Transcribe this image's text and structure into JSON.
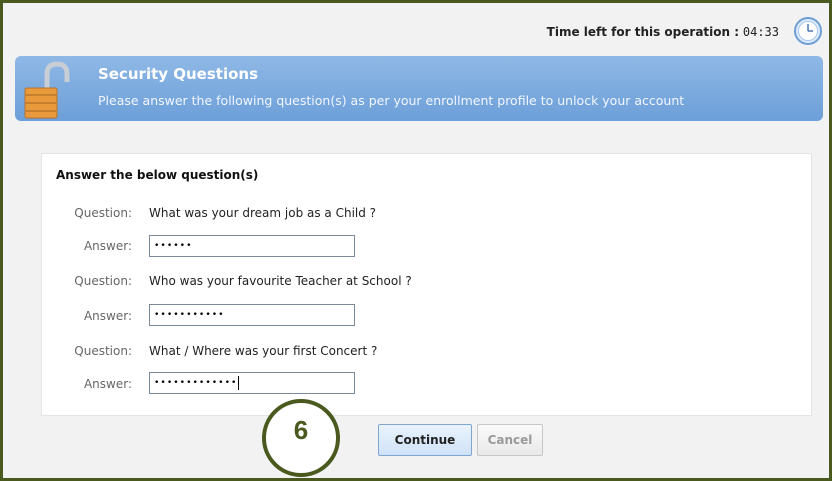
{
  "timer": {
    "label": "Time left for this operation :",
    "value": "04:33"
  },
  "header": {
    "title": "Security Questions",
    "subtitle": "Please answer the following question(s) as per your enrollment profile to unlock your account"
  },
  "panel": {
    "title": "Answer the below question(s)",
    "question_label": "Question:",
    "answer_label": "Answer:",
    "rows": [
      {
        "question": "What was your dream job as a Child ?",
        "answer_masked": "••••••"
      },
      {
        "question": "Who was your favourite Teacher at School ?",
        "answer_masked": "•••••••••••"
      },
      {
        "question": "What / Where was your first Concert ?",
        "answer_masked": "•••••••••••••"
      }
    ]
  },
  "buttons": {
    "continue": "Continue",
    "cancel": "Cancel"
  },
  "step_marker": "6",
  "colors": {
    "frame": "#4a5a1e",
    "header": "#7aaae0",
    "lock": "#e89a3c"
  },
  "icons": [
    "clock-icon",
    "padlock-icon"
  ]
}
